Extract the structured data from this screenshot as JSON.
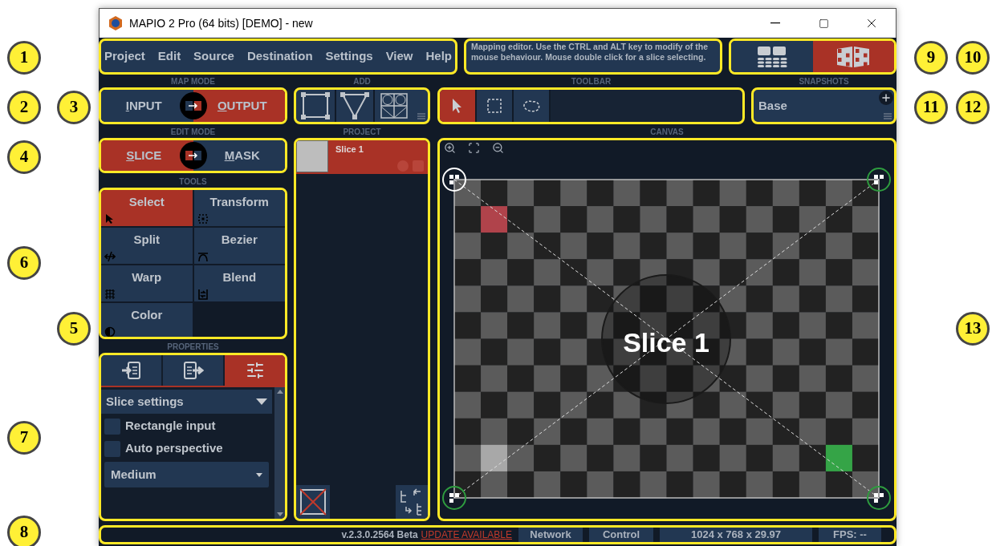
{
  "window": {
    "title": "MAPIO 2 Pro (64 bits) [DEMO] - new"
  },
  "menu": [
    "Project",
    "Edit",
    "Source",
    "Destination",
    "Settings",
    "View",
    "Help"
  ],
  "hint": "Mapping editor. Use the CTRL and ALT key to modify of the mouse behaviour. Mouse double click for a slice selecting.",
  "view_buttons": [
    {
      "selected": false
    },
    {
      "selected": true
    }
  ],
  "map_mode": {
    "label": "MAP MODE",
    "options": [
      {
        "label": "INPUT",
        "selected": false
      },
      {
        "label": "OUTPUT",
        "selected": true
      }
    ]
  },
  "add": {
    "label": "ADD"
  },
  "toolbar": {
    "label": "TOOLBAR",
    "tools": [
      {
        "selected": true
      },
      {
        "selected": false
      },
      {
        "selected": false
      }
    ]
  },
  "snapshots": {
    "label": "SNAPSHOTS",
    "current": "Base"
  },
  "edit_mode": {
    "label": "EDIT MODE",
    "options": [
      {
        "label": "SLICE",
        "selected": true
      },
      {
        "label": "MASK",
        "selected": false
      }
    ]
  },
  "tools": {
    "label": "TOOLS",
    "items": [
      {
        "label": "Select",
        "selected": true
      },
      {
        "label": "Transform",
        "selected": false
      },
      {
        "label": "Split",
        "selected": false
      },
      {
        "label": "Bezier",
        "selected": false
      },
      {
        "label": "Warp",
        "selected": false
      },
      {
        "label": "Blend",
        "selected": false
      },
      {
        "label": "Color",
        "selected": false
      }
    ]
  },
  "properties": {
    "label": "PROPERTIES",
    "tabs": [
      {
        "selected": false
      },
      {
        "selected": false
      },
      {
        "selected": true
      }
    ],
    "section": "Slice settings",
    "expanded": true,
    "checkboxes": [
      {
        "label": "Rectangle input",
        "checked": false
      },
      {
        "label": "Auto perspective",
        "checked": false
      }
    ],
    "quality": "Medium"
  },
  "project": {
    "label": "PROJECT",
    "slices": [
      {
        "name": "Slice 1",
        "selected": true
      }
    ]
  },
  "canvas": {
    "label": "CANVAS",
    "slice_name": "Slice 1"
  },
  "status_bar": {
    "version": "v.2.3.0.2564 Beta",
    "update_link": "UPDATE AVAILABLE",
    "cells": [
      "Network",
      "Control",
      "1024 x 768 x 29.97",
      "FPS: --"
    ]
  },
  "callouts": [
    "1",
    "2",
    "3",
    "4",
    "5",
    "6",
    "7",
    "8",
    "9",
    "10",
    "11",
    "12",
    "13"
  ]
}
